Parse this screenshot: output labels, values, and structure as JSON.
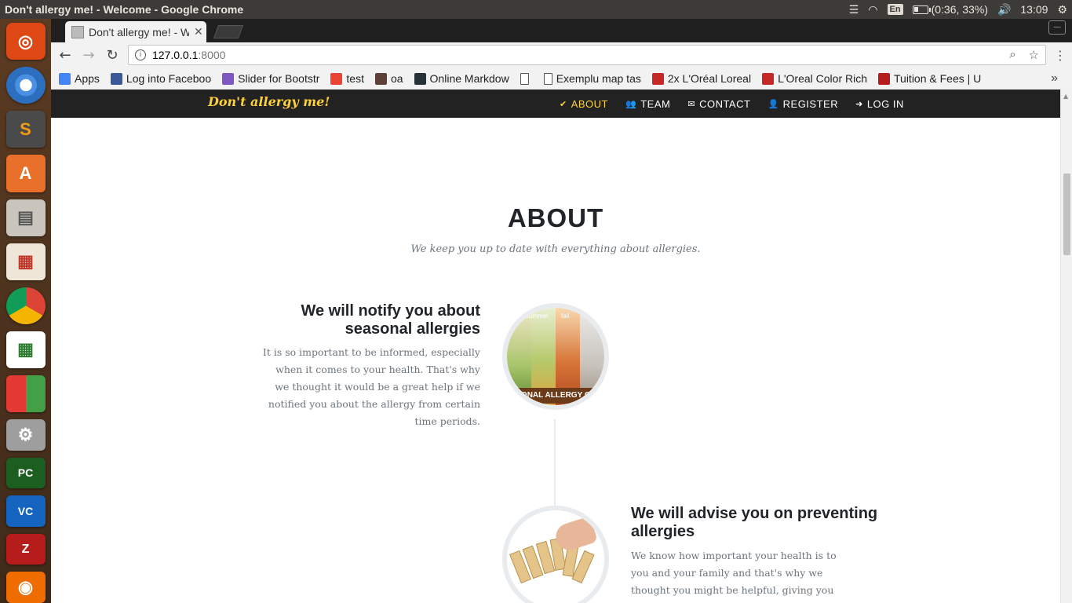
{
  "window": {
    "title": "Don't allergy me! - Welcome - Google Chrome",
    "tray": {
      "keyboard": "En",
      "battery": "(0:36, 33%)",
      "battery_level": 0.33,
      "time": "13:09"
    }
  },
  "launcher": {
    "items": [
      "ubuntu-dash",
      "chromium",
      "sublime-text",
      "software-center",
      "files",
      "impress",
      "chrome",
      "calc",
      "windows-app",
      "system-settings",
      "pycharm",
      "vscode",
      "filezilla",
      "blender"
    ]
  },
  "browser": {
    "tab_title": "Don't allergy me! - W",
    "address": {
      "host": "127.0.0.1",
      "port": ":8000"
    },
    "bookmarks": [
      {
        "label": "Apps",
        "icon": "apps-grid-icon",
        "color": "#4285f4"
      },
      {
        "label": "Log into Faceboo",
        "icon": "facebook-icon",
        "color": "#3b5998"
      },
      {
        "label": "Slider for Bootstr",
        "icon": "slider-icon",
        "color": "#7e57c2"
      },
      {
        "label": "test",
        "icon": "google-icon",
        "color": "#ea4335"
      },
      {
        "label": "oa",
        "icon": "hash-icon",
        "color": "#5d4037"
      },
      {
        "label": "Online Markdow",
        "icon": "d-icon",
        "color": "#263238"
      },
      {
        "label": "",
        "icon": "page-icon",
        "color": "#ffffff"
      },
      {
        "label": "Exemplu map tas",
        "icon": "page-icon",
        "color": "#ffffff"
      },
      {
        "label": "2x L'Oréal Loreal",
        "icon": "shop-icon",
        "color": "#c62828"
      },
      {
        "label": "L'Oreal Color Rich",
        "icon": "shop-icon",
        "color": "#c62828"
      },
      {
        "label": "Tuition & Fees | U",
        "icon": "university-icon",
        "color": "#b71c1c"
      }
    ],
    "more": "»"
  },
  "site": {
    "brand": "Don't allergy me!",
    "menu": [
      {
        "label": "ABOUT",
        "icon": "check-icon",
        "glyph": "✔",
        "active": true
      },
      {
        "label": "TEAM",
        "icon": "users-icon",
        "glyph": "👥",
        "active": false
      },
      {
        "label": "CONTACT",
        "icon": "envelope-icon",
        "glyph": "✉",
        "active": false
      },
      {
        "label": "REGISTER",
        "icon": "user-icon",
        "glyph": "👤",
        "active": false
      },
      {
        "label": "LOG IN",
        "icon": "sign-in-icon",
        "glyph": "➜",
        "active": false
      }
    ],
    "about": {
      "title": "ABOUT",
      "subtitle": "We keep you up to date with everything about allergies.",
      "items": [
        {
          "heading": "We will notify you about seasonal allergies",
          "text": "It is so important to be informed, especially when it comes to your health. That's why we thought it would be a great help if we notified you about the allergy from certain time periods.",
          "image_caption": "ONAL ALLERGY C",
          "image_labels": [
            "summer",
            "fall"
          ]
        },
        {
          "heading": "We will advise you on preventing allergies",
          "text": "We know how important your health is to you and your family and that's why we thought you might be helpful, giving you"
        }
      ]
    }
  }
}
